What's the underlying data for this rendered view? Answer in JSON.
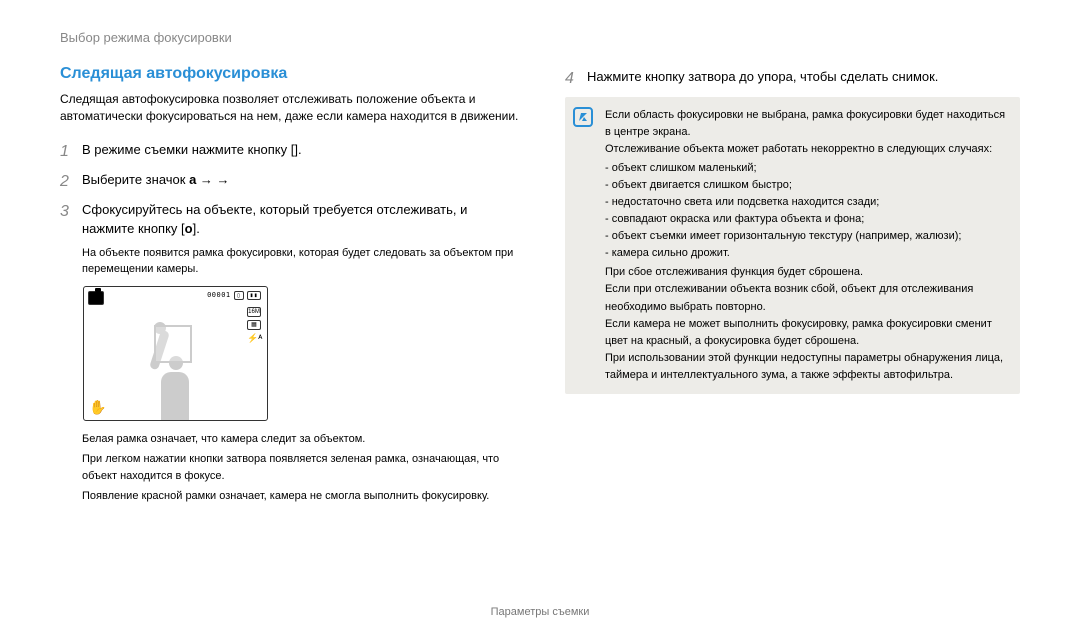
{
  "page_header": "Выбор режима фокусировки",
  "section_title": "Следящая автофокусировка",
  "intro": "Следящая автофокусировка позволяет отслеживать положение объекта и автоматически фокусироваться на нем, даже если камера находится в движении.",
  "steps": [
    {
      "num": "1",
      "text_a": "В режиме съемки нажмите кнопку [",
      "text_b": "]."
    },
    {
      "num": "2",
      "text_a": "Выберите значок ",
      "bold1": "a",
      "arrow1": " →",
      "icon1": "☐",
      "arrow2": " → ",
      "icon2": "▢.",
      "text_b": ""
    },
    {
      "num": "3",
      "text_a": "Сфокусируйтесь на объекте, который требуется отслеживать, и нажмите кнопку [",
      "bold1": "o",
      "text_b": "]."
    }
  ],
  "step3_sub": "На объекте появится рамка фокусировки, которая будет следовать за объектом при перемещении камеры.",
  "preview": {
    "counter": "00001",
    "res": "16M"
  },
  "notes": [
    "Белая рамка означает, что камера следит за объектом.",
    "При легком нажатии кнопки затвора появляется зеленая рамка, означающая, что объект находится в фокусе.",
    "Появление красной рамки означает, камера не смогла выполнить фокусировку."
  ],
  "step4": {
    "num": "4",
    "text": "Нажмите кнопку затвора до упора, чтобы сделать снимок."
  },
  "infobox": {
    "line1": "Если область фокусировки не выбрана, рамка фокусировки будет находиться в центре экрана.",
    "line2": "Отслеживание объекта может работать некорректно в следующих случаях:",
    "bullets": [
      "объект слишком маленький;",
      "объект двигается слишком быстро;",
      "недостаточно света или подсветка находится сзади;",
      "совпадают окраска или фактура объекта и фона;",
      "объект съемки имеет горизонтальную текстуру (например, жалюзи);",
      "камера сильно дрожит."
    ],
    "line3": "При сбое отслеживания функция будет сброшена.",
    "line4": "Если при отслеживании объекта возник сбой, объект для отслеживания необходимо выбрать повторно.",
    "line5": "Если камера не может выполнить фокусировку, рамка фокусировки сменит цвет на красный, а фокусировка будет сброшена.",
    "line6": "При использовании этой функции недоступны параметры обнаружения лица, таймера и интеллектуального зума, а также эффекты автофильтра."
  },
  "footer": "Параметры съемки"
}
